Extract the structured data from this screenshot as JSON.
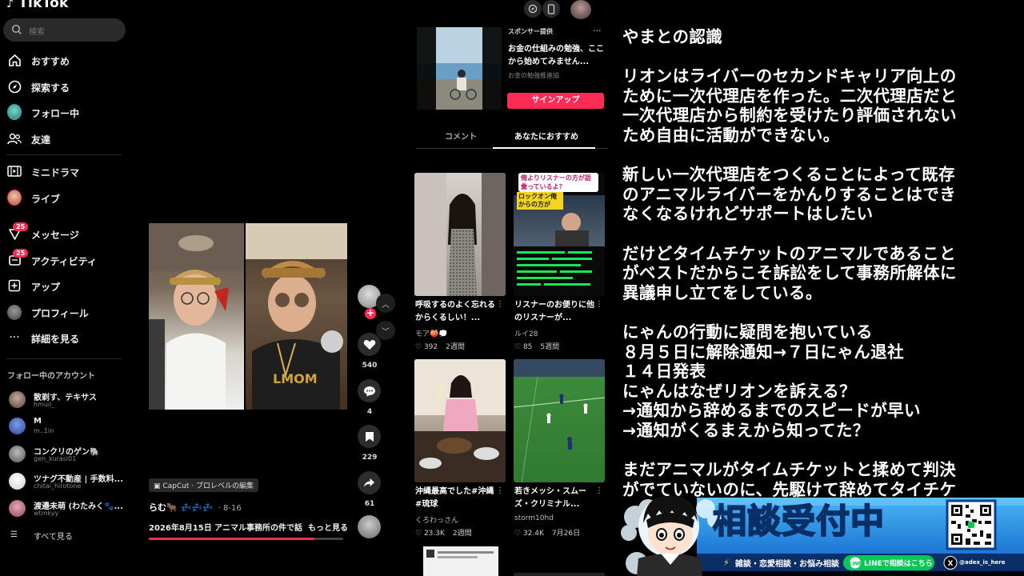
{
  "app": {
    "logo_text": "TikTok"
  },
  "sidebar": {
    "search_placeholder": "検索",
    "items": [
      {
        "label": "おすすめ",
        "icon": "home-icon"
      },
      {
        "label": "探索する",
        "icon": "compass-icon"
      },
      {
        "label": "フォロー中",
        "icon": "following-avatar"
      },
      {
        "label": "友達",
        "icon": "friends-icon"
      },
      {
        "label": "ミニドラマ",
        "icon": "drama-icon"
      },
      {
        "label": "ライブ",
        "icon": "live-avatar"
      },
      {
        "label": "メッセージ",
        "icon": "message-icon",
        "badge": "25"
      },
      {
        "label": "アクティビティ",
        "icon": "activity-icon",
        "badge": "25"
      },
      {
        "label": "アップ",
        "icon": "upload-icon"
      },
      {
        "label": "プロフィール",
        "icon": "profile-avatar"
      },
      {
        "label": "詳細を見る",
        "icon": "more-icon"
      }
    ],
    "following_title": "フォロー中のアカウント",
    "accounts": [
      {
        "name": "散剃す、テキサス",
        "handle": "hmuii_"
      },
      {
        "name": "M",
        "handle": "m..1in"
      },
      {
        "name": "コンクリのゲン🐘",
        "handle": "gen_kurasi01"
      },
      {
        "name": "ツナグ不動産 | 手数料...",
        "handle": "chitai_hirotone"
      },
      {
        "name": "渡邉未萌 (わたみく🐾...",
        "handle": "wtmkyy"
      }
    ],
    "see_all": "すべて見る"
  },
  "video": {
    "caption_tag": "CapCut · プロレベルの編集",
    "username": "らむ🐂 💤💤💤",
    "date": "· 8-16",
    "description": "2026年8月15日 アニマル事務所の件で話",
    "more": "もっと見る",
    "progress": 0.85,
    "likes": "540",
    "comments": "4",
    "saves": "229",
    "shares": "61"
  },
  "ad": {
    "label": "スポンサー提供",
    "title": "お金の仕組みの勉強、ここから始めてみません...",
    "sub": "お金の勉強推進協",
    "button": "サインアップ"
  },
  "tabs": {
    "comments": "コメント",
    "recommended": "あなたにおすすめ"
  },
  "cards": [
    {
      "title": "呼吸するのよく忘れるからくるしい！...",
      "author": "モア🍑💭",
      "likes": "392",
      "date": "2週間"
    },
    {
      "title": "リスナーのお便りに他のリスナーが...",
      "author": "ルイ28",
      "likes": "85",
      "date": "5週間",
      "overlay_top": "俺よりリスナーの方が語彙っているよ？",
      "overlay_mid": "ロックオン俺からの方が"
    },
    {
      "title": "沖縄最高でした#沖縄#琉球",
      "author": "くろわっさん",
      "likes": "23.3K",
      "date": "2週間"
    },
    {
      "title": "若きメッシ・スムーズ・クリミナル...",
      "author": "storm10hd",
      "likes": "32.4K",
      "date": "7月26日"
    }
  ],
  "right_panel": {
    "lines": [
      "やまとの認識",
      "",
      "リオンはライバーのセカンドキャリア向上の",
      "ために一次代理店を作った。二次代理店だと",
      "一次代理店から制約を受けたり評価されない",
      "ため自由に活動ができない。",
      "",
      "新しい一次代理店をつくることによって既存",
      "のアニマルライバーをかんりすることはでき",
      "なくなるけれどサポートはしたい",
      "",
      "だけどタイムチケットのアニマルであること",
      "がベストだからこそ訴訟をして事務所解体に",
      "異議申し立てをしている。",
      "",
      "にゃんの行動に疑問を抱いている",
      "８月５日に解除通知→７日にゃん退社",
      "１４日発表",
      "にゃんはなぜリオンを訴える？",
      "→通知から辞めるまでのスピードが早い",
      "→通知がくるまえから知ってた？",
      "",
      "まだアニマルがタイムチケットと揉めて判決",
      "がでていないのに、先駆けて辞めてタイチケ"
    ]
  },
  "banner": {
    "main": "相談受付中",
    "main_a": "相談",
    "main_b": "受付中",
    "sub": "雑談・恋愛相談・お悩み相談",
    "line_btn": "LINEで相談はこちら",
    "x_handle": "@adex_is_here"
  },
  "colors": {
    "accent": "#fe2c55",
    "bg": "#000000",
    "banner_blue": "#1a8fe0"
  }
}
